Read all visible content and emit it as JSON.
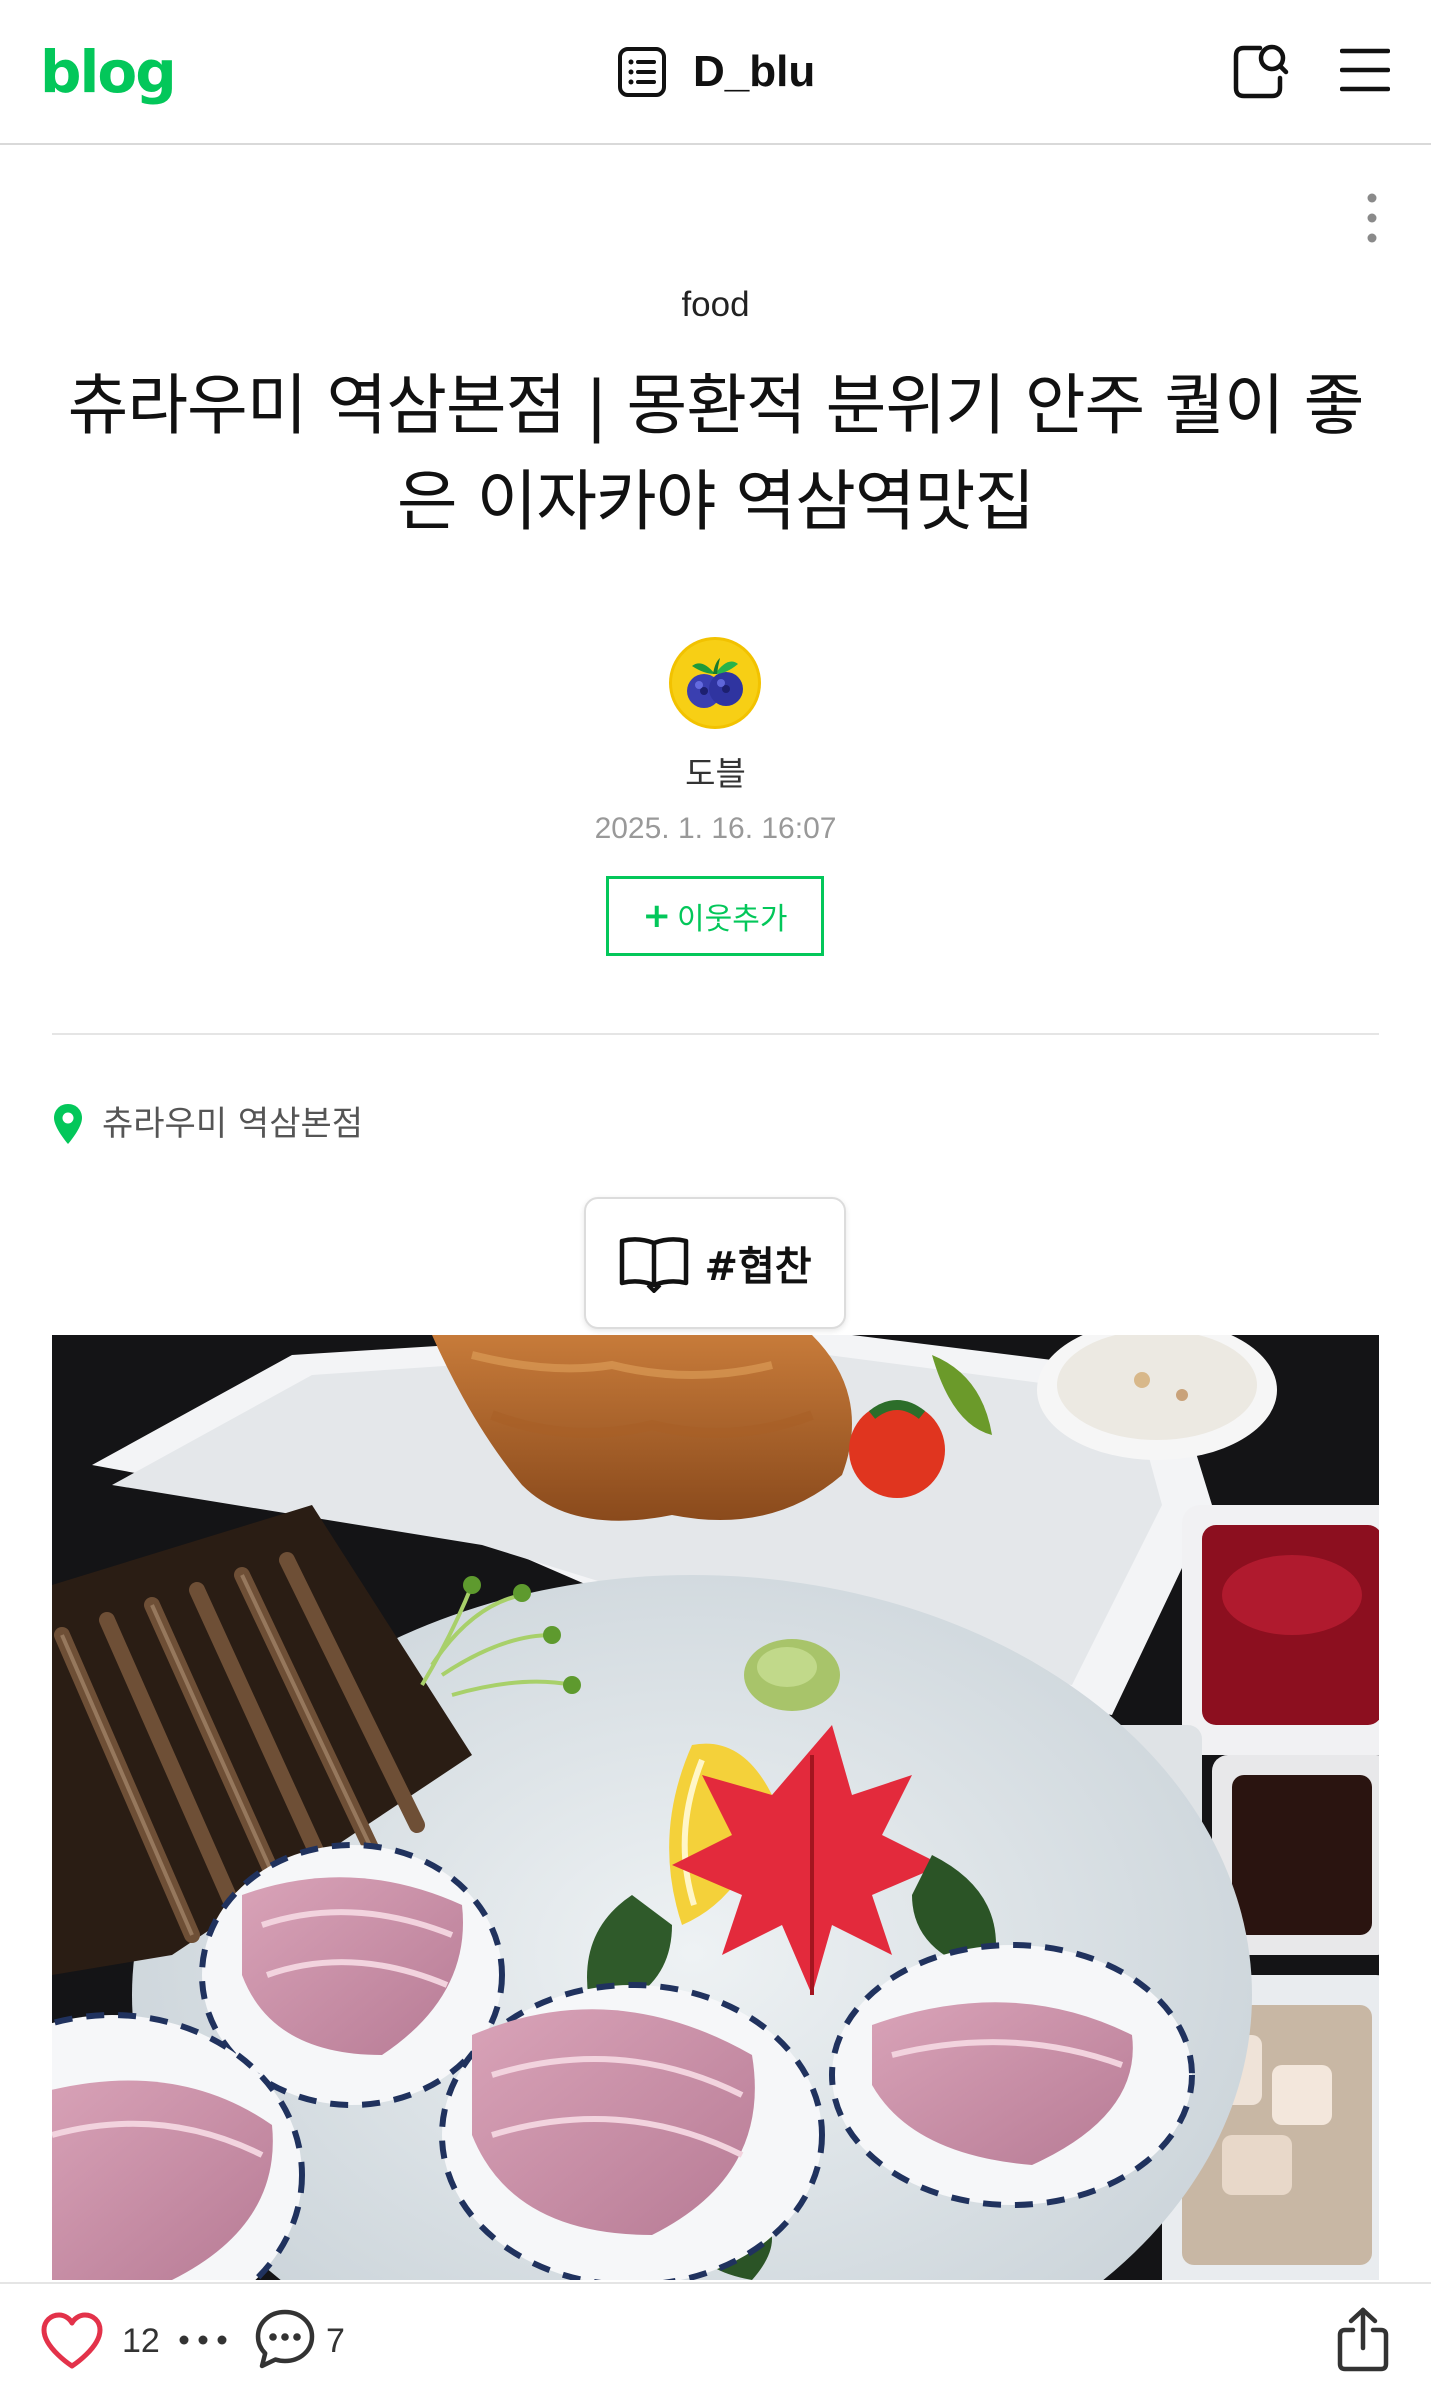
{
  "header": {
    "logo": "blog",
    "blog_name": "D_blu"
  },
  "post": {
    "category": "food",
    "title": "츄라우미 역삼본점 | 몽환적 분위기 안주 퀄이 좋은 이자카야 역삼역맛집",
    "author": "도블",
    "date": "2025. 1. 16. 16:07",
    "neighbor_button": {
      "plus": "+",
      "label": "이웃추가"
    },
    "location": "츄라우미 역삼본점",
    "tag": "#협찬"
  },
  "bottom_bar": {
    "like_count": "12",
    "comment_count": "7"
  },
  "colors": {
    "brand": "#03c75a",
    "text": "#111111",
    "muted": "#999999",
    "divider": "#e5e5e5"
  },
  "icons": {
    "list": "list-icon",
    "search": "search-icon",
    "menu": "menu-icon",
    "more": "more-vertical-icon",
    "pin": "location-pin-icon",
    "book": "book-icon",
    "like": "heart-icon",
    "comment": "comment-icon",
    "share": "share-icon"
  }
}
